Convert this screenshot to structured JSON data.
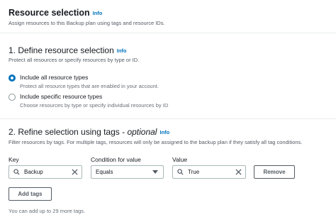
{
  "header": {
    "title": "Resource selection",
    "info": "Info",
    "description": "Assign resources to this Backup plan using tags and resource IDs."
  },
  "define": {
    "title": "1. Define resource selection",
    "info": "Info",
    "description": "Protect all resources or specify resources by type or ID.",
    "options": [
      {
        "label": "Include all resource types",
        "description": "Protect all resource types that are enabled in your account.",
        "checked": true
      },
      {
        "label": "Include specific resource types",
        "description": "Choose resources by type or specify individual resources by ID",
        "checked": false
      }
    ]
  },
  "refine": {
    "title_main": "2. Refine selection using tags - ",
    "title_optional": "optional",
    "info": "Info",
    "description": "Filter resources by tags. For multiple tags, resources will only be assigned to the backup plan if they satisfy all tag conditions.",
    "key_label": "Key",
    "condition_label": "Condition for value",
    "value_label": "Value",
    "key_value": "Backup",
    "condition_value": "Equals",
    "value_value": "True",
    "remove_label": "Remove",
    "add_tags_label": "Add tags",
    "footer": "You can add up to 29 more tags."
  },
  "colors": {
    "accent": "#0073bb",
    "text": "#16191f",
    "muted": "#687078",
    "border": "#aab7b8"
  }
}
